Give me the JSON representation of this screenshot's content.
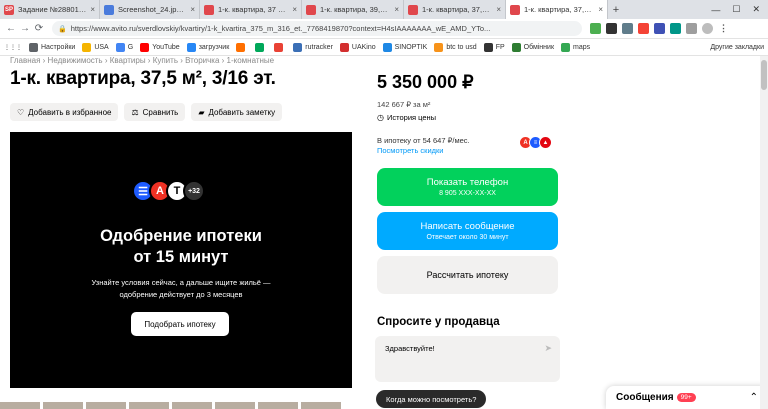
{
  "browser": {
    "tabs": [
      {
        "title": "Задание №2880173 - ...",
        "fav": "SP",
        "color": "#e0474c",
        "active": false
      },
      {
        "title": "Screenshot_24.jpg — Як...",
        "fav": "",
        "color": "#4a7bdc",
        "active": false
      },
      {
        "title": "1-к. квартира, 37 м2, 3/...",
        "fav": "",
        "color": "#e0474c",
        "active": false
      },
      {
        "title": "1-к. квартира, 39,5 м2...",
        "fav": "",
        "color": "#e0474c",
        "active": false
      },
      {
        "title": "1-к. квартира, 37,4 м2...",
        "fav": "",
        "color": "#e0474c",
        "active": false
      },
      {
        "title": "1-к. квартира, 37,5 м2...",
        "fav": "",
        "color": "#e0474c",
        "active": true
      }
    ],
    "new_tab": "+",
    "url": "https://www.avito.ru/sverdlovskiy/kvartiry/1-k_kvartira_375_m_316_et._7768419870?context=H4sIAAAAAAA_wE_AMD_YTo...",
    "bookmarks": [
      {
        "label": "Настройки",
        "color": "#5f6368"
      },
      {
        "label": "USA",
        "color": "#f5b400"
      },
      {
        "label": "G",
        "color": "#4285f4"
      },
      {
        "label": "YouTube",
        "color": "#ff0000"
      },
      {
        "label": "загрузчик",
        "color": "#2787f5"
      },
      {
        "label": "",
        "color": "#ff6f00"
      },
      {
        "label": "",
        "color": "#00a85a"
      },
      {
        "label": "",
        "color": "#e94235"
      },
      {
        "label": "rutracker",
        "color": "#3b6fb6"
      },
      {
        "label": "UAKino",
        "color": "#d32f2f"
      },
      {
        "label": "SINOPTIK",
        "color": "#1e88e5"
      },
      {
        "label": "btc to usd",
        "color": "#f7931a"
      },
      {
        "label": "FP",
        "color": "#333333"
      },
      {
        "label": "Обмінник",
        "color": "#2e7d32"
      },
      {
        "label": "maps",
        "color": "#34a853"
      }
    ],
    "other_bookmarks": "Другие закладки"
  },
  "page": {
    "breadcrumb": "Главная › Недвижимость › Квартиры › Купить › Вторичка › 1-комнатные",
    "title": "1-к. квартира, 37,5 м², 3/16 эт.",
    "actions": {
      "favorite": "Добавить в избранное",
      "compare": "Сравнить",
      "note": "Добавить заметку"
    },
    "banner": {
      "extra_banks": "+32",
      "headline_1": "Одобрение ипотеки",
      "headline_2": "от 15 минут",
      "text_1": "Узнайте условия сейчас, а дальше ищите жильё —",
      "text_2": "одобрение действует до 3 месяцев",
      "button": "Подобрать ипотеку"
    },
    "price": "5 350 000 ₽",
    "price_per_sqm": "142 667 ₽ за м²",
    "price_history": "История цены",
    "mortgage_from": "В ипотеку от 54 647 ₽/мес.",
    "see_discounts": "Посмотреть скидки",
    "show_phone": "Показать телефон",
    "phone_masked": "8 905 XXX-XX-XX",
    "write_message": "Написать сообщение",
    "reply_time": "Отвечает около 30 минут",
    "calc_mortgage": "Рассчитать ипотеку",
    "ask_seller": "Спросите у продавца",
    "ask_default": "Здравствуйте!",
    "quick_question": "Когда можно посмотреть?",
    "messenger_label": "Сообщения",
    "messenger_badge": "99+"
  },
  "colors": {
    "green": "#02d15c",
    "blue": "#00aaff",
    "grey_btn": "#f2f1f0",
    "link": "#0099f7"
  }
}
